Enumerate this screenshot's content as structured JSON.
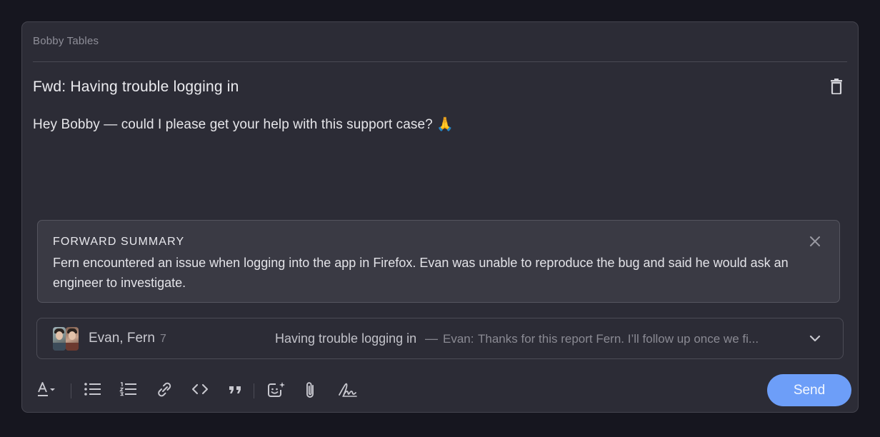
{
  "compose": {
    "to": "Bobby Tables",
    "subject": "Fwd: Having trouble logging in",
    "body": "Hey Bobby — could I please get your help with this support case? 🙏"
  },
  "summary": {
    "heading": "FORWARD SUMMARY",
    "text": "Fern encountered an issue when logging into the app in Firefox. Evan was unable to reproduce the bug and said he would ask an engineer to investigate."
  },
  "thread": {
    "participants": "Evan, Fern",
    "count": "7",
    "subject": "Having trouble logging in",
    "separator": "—",
    "last_author": "Evan:",
    "snippet": "Thanks for this report Fern. I’ll follow up once we fi..."
  },
  "toolbar": {
    "icons": [
      "text-format-icon",
      "bulleted-list-icon",
      "numbered-list-icon",
      "link-icon",
      "code-icon",
      "quote-icon",
      "emoji-icon",
      "attachment-icon",
      "signature-icon"
    ]
  },
  "send_label": "Send",
  "colors": {
    "background": "#16161f",
    "panel": "#2c2c36",
    "accent": "#6d9ef8"
  }
}
